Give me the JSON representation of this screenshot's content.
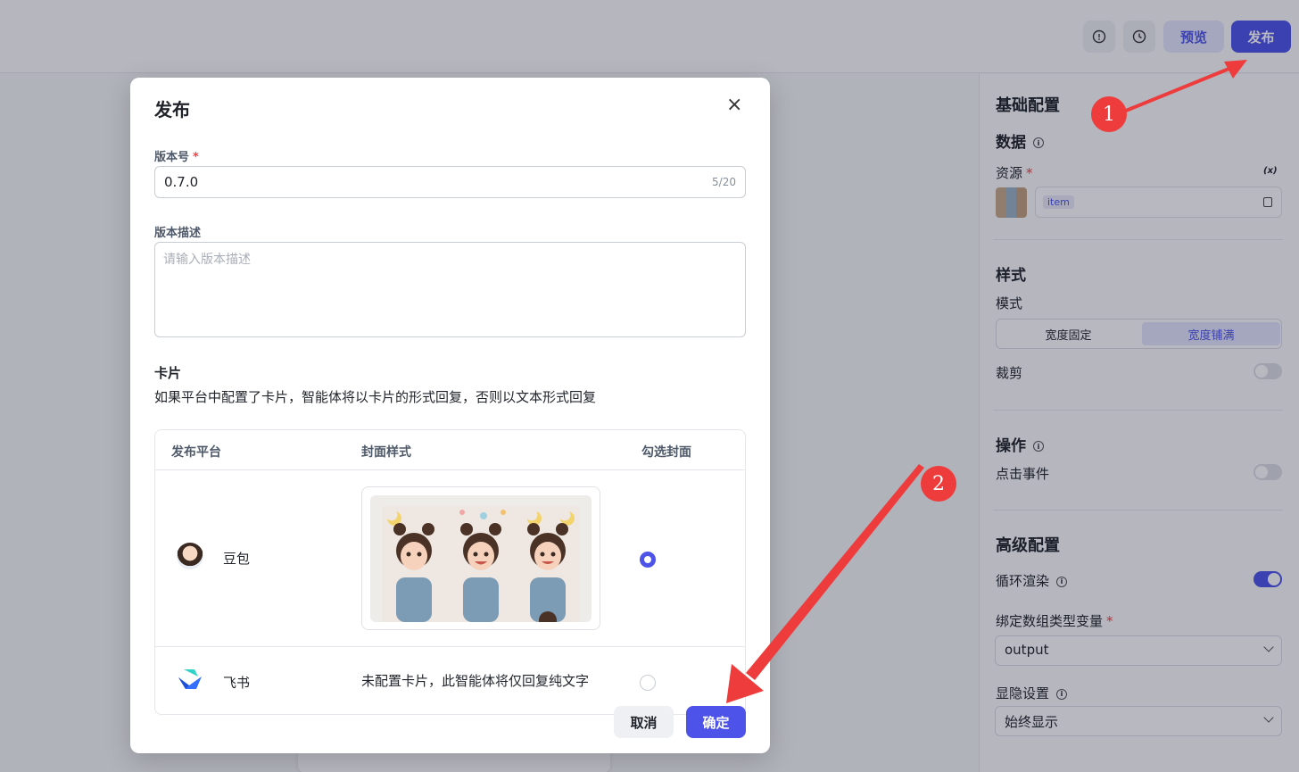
{
  "topbar": {
    "preview_label": "预览",
    "publish_label": "发布"
  },
  "right_panel": {
    "basic_config": "基础配置",
    "data_title": "数据",
    "resource_label": "资源",
    "resource_var_icon": "(x)",
    "resource_tag": "item",
    "style_title": "样式",
    "mode_label": "模式",
    "mode_options": [
      "宽度固定",
      "宽度铺满"
    ],
    "mode_selected": "宽度铺满",
    "crop_label": "裁剪",
    "crop_on": false,
    "action_title": "操作",
    "click_event_label": "点击事件",
    "click_event_on": false,
    "advanced_title": "高级配置",
    "loop_render_label": "循环渲染",
    "loop_render_on": true,
    "bind_array_label": "绑定数组类型变量",
    "bind_array_value": "output",
    "visibility_label": "显隐设置",
    "visibility_value": "始终显示"
  },
  "modal": {
    "title": "发布",
    "version_label": "版本号",
    "version_value": "0.7.0",
    "version_count": "5/20",
    "desc_label": "版本描述",
    "desc_placeholder": "请输入版本描述",
    "card_title": "卡片",
    "card_desc": "如果平台中配置了卡片，智能体将以卡片的形式回复，否则以文本形式回复",
    "table": {
      "headers": [
        "发布平台",
        "封面样式",
        "勾选封面"
      ],
      "rows": [
        {
          "platform": "豆包",
          "cover": "image",
          "selected": true
        },
        {
          "platform": "飞书",
          "cover_text": "未配置卡片，此智能体将仅回复纯文字",
          "selected": false
        }
      ]
    },
    "cancel_label": "取消",
    "confirm_label": "确定"
  },
  "annotations": {
    "marker_1": "1",
    "marker_2": "2",
    "arrow_color": "#ee3b3b"
  },
  "colors": {
    "accent": "#4d53e8",
    "danger": "#f53f3f"
  }
}
